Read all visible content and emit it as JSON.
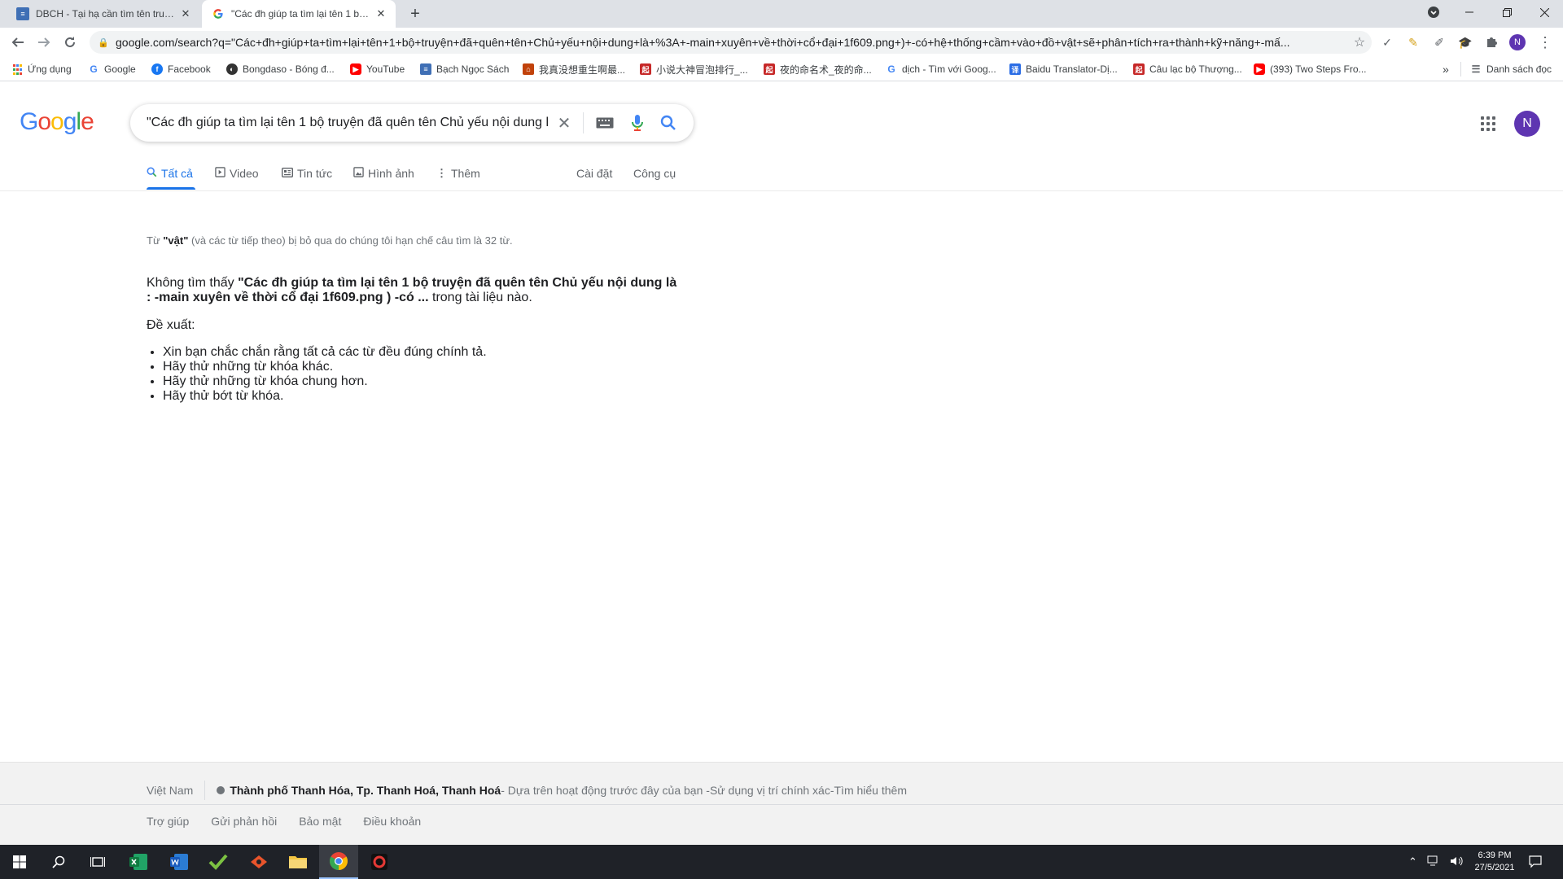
{
  "browser": {
    "tabs": [
      {
        "title": "DBCH - Tại hạ cần tìm tên truyện...",
        "active": false
      },
      {
        "title": "\"Các đh giúp ta tìm lại tên 1 bộ truyện...",
        "active": true
      }
    ],
    "new_tab": "+",
    "url": "google.com/search?q=\"Các+đh+giúp+ta+tìm+lại+tên+1+bộ+truyện+đã+quên+tên+Chủ+yếu+nội+dung+là+%3A+-main+xuyên+về+thời+cổ+đại+1f609.png+)+-có+hệ+thống+cầm+vào+đồ+vật+sẽ+phân+tích+ra+thành+kỹ+năng+-mấ..."
  },
  "bookmarks": [
    {
      "label": "Ứng dụng",
      "icon": "apps-icon",
      "color": "#1a73e8"
    },
    {
      "label": "Google",
      "icon": "google-icon",
      "color": "#4285f4"
    },
    {
      "label": "Facebook",
      "icon": "facebook-icon",
      "color": "#1877f2"
    },
    {
      "label": "Bongdaso - Bóng đ...",
      "icon": "globe-icon",
      "color": "#333333"
    },
    {
      "label": "YouTube",
      "icon": "youtube-icon",
      "color": "#ff0000"
    },
    {
      "label": "Bạch Ngọc Sách",
      "icon": "book-icon",
      "color": "#3f6fb5"
    },
    {
      "label": "我真没想重生啊最...",
      "icon": "site-icon",
      "color": "#c1420b"
    },
    {
      "label": "小说大神冒泡排行_...",
      "icon": "site-icon",
      "color": "#c62828"
    },
    {
      "label": "夜的命名术_夜的命...",
      "icon": "site-icon",
      "color": "#c62828"
    },
    {
      "label": "dịch - Tìm với Goog...",
      "icon": "google-icon",
      "color": "#4285f4"
    },
    {
      "label": "Baidu Translator-Dị...",
      "icon": "baidu-icon",
      "color": "#2b6de5"
    },
    {
      "label": "Câu lạc bộ Thượng...",
      "icon": "site-icon",
      "color": "#c62828"
    },
    {
      "label": "(393) Two Steps Fro...",
      "icon": "youtube-icon",
      "color": "#ff0000"
    }
  ],
  "bookmarks_more": "»",
  "reading_list": "Danh sách đọc",
  "google": {
    "logo": "Google",
    "query": "\"Các đh giúp ta tìm lại tên 1 bộ truyện đã quên tên Chủ yếu nội dung l",
    "avatar_letter": "N",
    "tabs": [
      {
        "label": "Tất cả",
        "icon": "search-icon",
        "selected": true
      },
      {
        "label": "Video",
        "icon": "video-icon",
        "selected": false
      },
      {
        "label": "Tin tức",
        "icon": "news-icon",
        "selected": false
      },
      {
        "label": "Hình ảnh",
        "icon": "image-icon",
        "selected": false
      },
      {
        "label": "Thêm",
        "icon": "more-vert-icon",
        "selected": false
      }
    ],
    "settings": "Cài đặt",
    "tools": "Công cụ"
  },
  "results": {
    "omit_prefix": "Từ ",
    "omit_word": "\"vật\"",
    "omit_suffix": " (và các từ tiếp theo) bị bỏ qua do chúng tôi hạn chế câu tìm là 32 từ.",
    "notfound_prefix": "Không tìm thấy ",
    "notfound_query": "\"Các đh giúp ta tìm lại tên 1 bộ truyện đã quên tên Chủ yếu nội dung là : -main xuyên về thời cổ đại 1f609.png ) -có ...",
    "notfound_suffix": " trong tài liệu nào.",
    "suggest_label": "Đề xuất:",
    "suggestions": [
      "Xin bạn chắc chắn rằng tất cả các từ đều đúng chính tả.",
      "Hãy thử những từ khóa khác.",
      "Hãy thử những từ khóa chung hơn.",
      "Hãy thử bớt từ khóa."
    ]
  },
  "footer": {
    "country": "Việt Nam",
    "location": "Thành phố Thanh Hóa, Tp. Thanh Hoá, Thanh Hoá",
    "based_on": " - Dựa trên hoạt động trước đây của bạn - ",
    "precise": "Sử dụng vị trí chính xác",
    "sep": " - ",
    "learn_more": "Tìm hiểu thêm",
    "links": [
      "Trợ giúp",
      "Gửi phản hồi",
      "Bảo mật",
      "Điều khoản"
    ]
  },
  "taskbar": {
    "time": "6:39 PM",
    "date": "27/5/2021"
  }
}
